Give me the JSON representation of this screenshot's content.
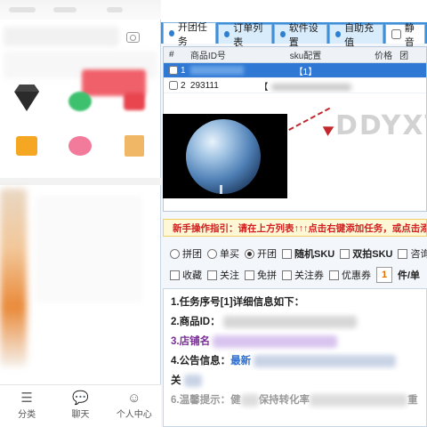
{
  "left_panel": {
    "bottom_tabs": [
      {
        "icon": "grid-icon",
        "label": "分类"
      },
      {
        "icon": "chat-icon",
        "label": "聊天"
      },
      {
        "icon": "person-icon",
        "label": "个人中心"
      }
    ]
  },
  "right_panel": {
    "tabs": [
      {
        "label": "开团任务",
        "active": true
      },
      {
        "label": "订单列表"
      },
      {
        "label": "软件设置"
      },
      {
        "label": "自助充值"
      }
    ],
    "mute_label": "静音",
    "table": {
      "headers": [
        "#",
        "商品ID号",
        "sku配置",
        "价格",
        "团"
      ],
      "rows": [
        {
          "num": "1",
          "id": "",
          "sku": "【1】",
          "selected": true
        },
        {
          "num": "2",
          "id": "293111",
          "sku": "【",
          "selected": false
        }
      ]
    },
    "watermark": "DDYXT",
    "guide_text": "新手操作指引：请在上方列表↑↑↑点击右键添加任务，或点击添加任",
    "options_row1": [
      {
        "type": "radio",
        "label": "拼团",
        "checked": false
      },
      {
        "type": "radio",
        "label": "单买",
        "checked": false
      },
      {
        "type": "radio",
        "label": "开团",
        "checked": true
      },
      {
        "type": "check",
        "label": "随机SKU",
        "bold": true
      },
      {
        "type": "check",
        "label": "双拍SKU",
        "bold": true
      },
      {
        "type": "check",
        "label": "咨询"
      }
    ],
    "options_row2": [
      {
        "label": "收藏"
      },
      {
        "label": "关注"
      },
      {
        "label": "免拼"
      },
      {
        "label": "关注券"
      },
      {
        "label": "优惠券"
      }
    ],
    "quantity": "1",
    "quantity_suffix": "件/单",
    "info": {
      "line1": "1.任务序号[1]详细信息如下：",
      "line2": "2.商品ID：",
      "line3": "3.店铺名",
      "line4_prefix": "4.公告信息：",
      "line4_link": "最新",
      "line5": "关",
      "line6_prefix": "6.温馨提示：健",
      "line6_mid": "保持转化率",
      "line6_end": "重！"
    }
  }
}
